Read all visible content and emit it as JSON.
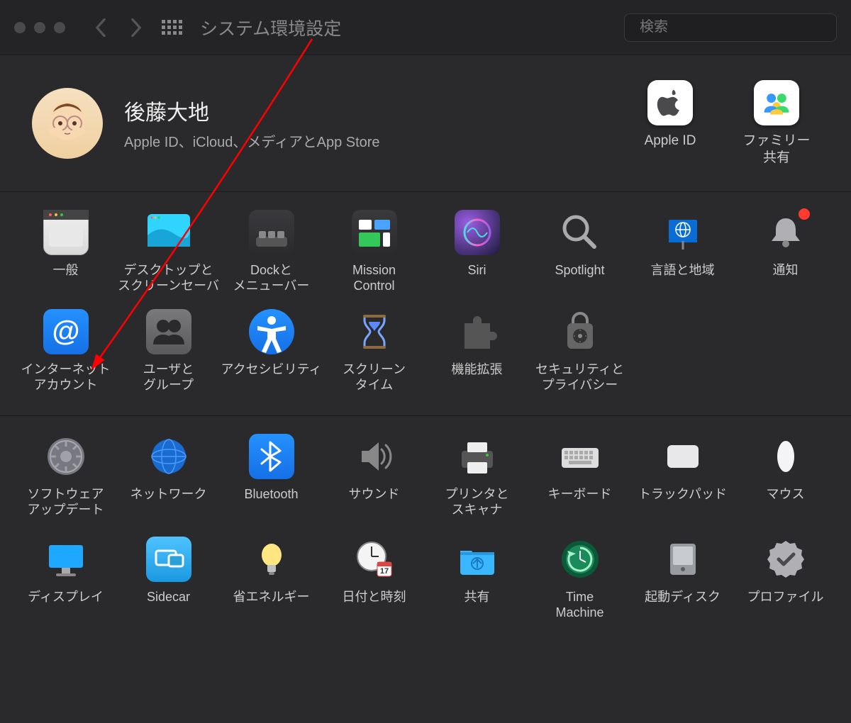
{
  "window": {
    "title": "システム環境設定",
    "search_placeholder": "検索"
  },
  "account": {
    "name": "後藤大地",
    "subtitle": "Apple ID、iCloud、メディアとApp Store",
    "apple_id_label": "Apple ID",
    "family_label": "ファミリー\n共有"
  },
  "row1": [
    {
      "label": "一般",
      "icon": "general"
    },
    {
      "label": "デスクトップと\nスクリーンセーバ",
      "icon": "desktop"
    },
    {
      "label": "Dockと\nメニューバー",
      "icon": "dock"
    },
    {
      "label": "Mission\nControl",
      "icon": "mission"
    },
    {
      "label": "Siri",
      "icon": "siri"
    },
    {
      "label": "Spotlight",
      "icon": "spotlight"
    },
    {
      "label": "言語と地域",
      "icon": "language"
    },
    {
      "label": "通知",
      "icon": "notifications"
    }
  ],
  "row2": [
    {
      "label": "インターネット\nアカウント",
      "icon": "internet"
    },
    {
      "label": "ユーザと\nグループ",
      "icon": "users"
    },
    {
      "label": "アクセシビリティ",
      "icon": "a11y"
    },
    {
      "label": "スクリーン\nタイム",
      "icon": "screentime"
    },
    {
      "label": "機能拡張",
      "icon": "extensions"
    },
    {
      "label": "セキュリティと\nプライバシー",
      "icon": "security"
    }
  ],
  "row3": [
    {
      "label": "ソフトウェア\nアップデート",
      "icon": "update"
    },
    {
      "label": "ネットワーク",
      "icon": "network"
    },
    {
      "label": "Bluetooth",
      "icon": "bluetooth"
    },
    {
      "label": "サウンド",
      "icon": "sound"
    },
    {
      "label": "プリンタと\nスキャナ",
      "icon": "printer"
    },
    {
      "label": "キーボード",
      "icon": "keyboard"
    },
    {
      "label": "トラックパッド",
      "icon": "trackpad"
    },
    {
      "label": "マウス",
      "icon": "mouse"
    }
  ],
  "row4": [
    {
      "label": "ディスプレイ",
      "icon": "display"
    },
    {
      "label": "Sidecar",
      "icon": "sidecar"
    },
    {
      "label": "省エネルギー",
      "icon": "energy"
    },
    {
      "label": "日付と時刻",
      "icon": "datetime"
    },
    {
      "label": "共有",
      "icon": "sharing"
    },
    {
      "label": "Time\nMachine",
      "icon": "timemachine"
    },
    {
      "label": "起動ディスク",
      "icon": "startup"
    },
    {
      "label": "プロファイル",
      "icon": "profiles"
    }
  ],
  "annotation": {
    "arrow_from": "grid-view-button",
    "arrow_to": "internet-accounts",
    "color": "#ff0000"
  }
}
